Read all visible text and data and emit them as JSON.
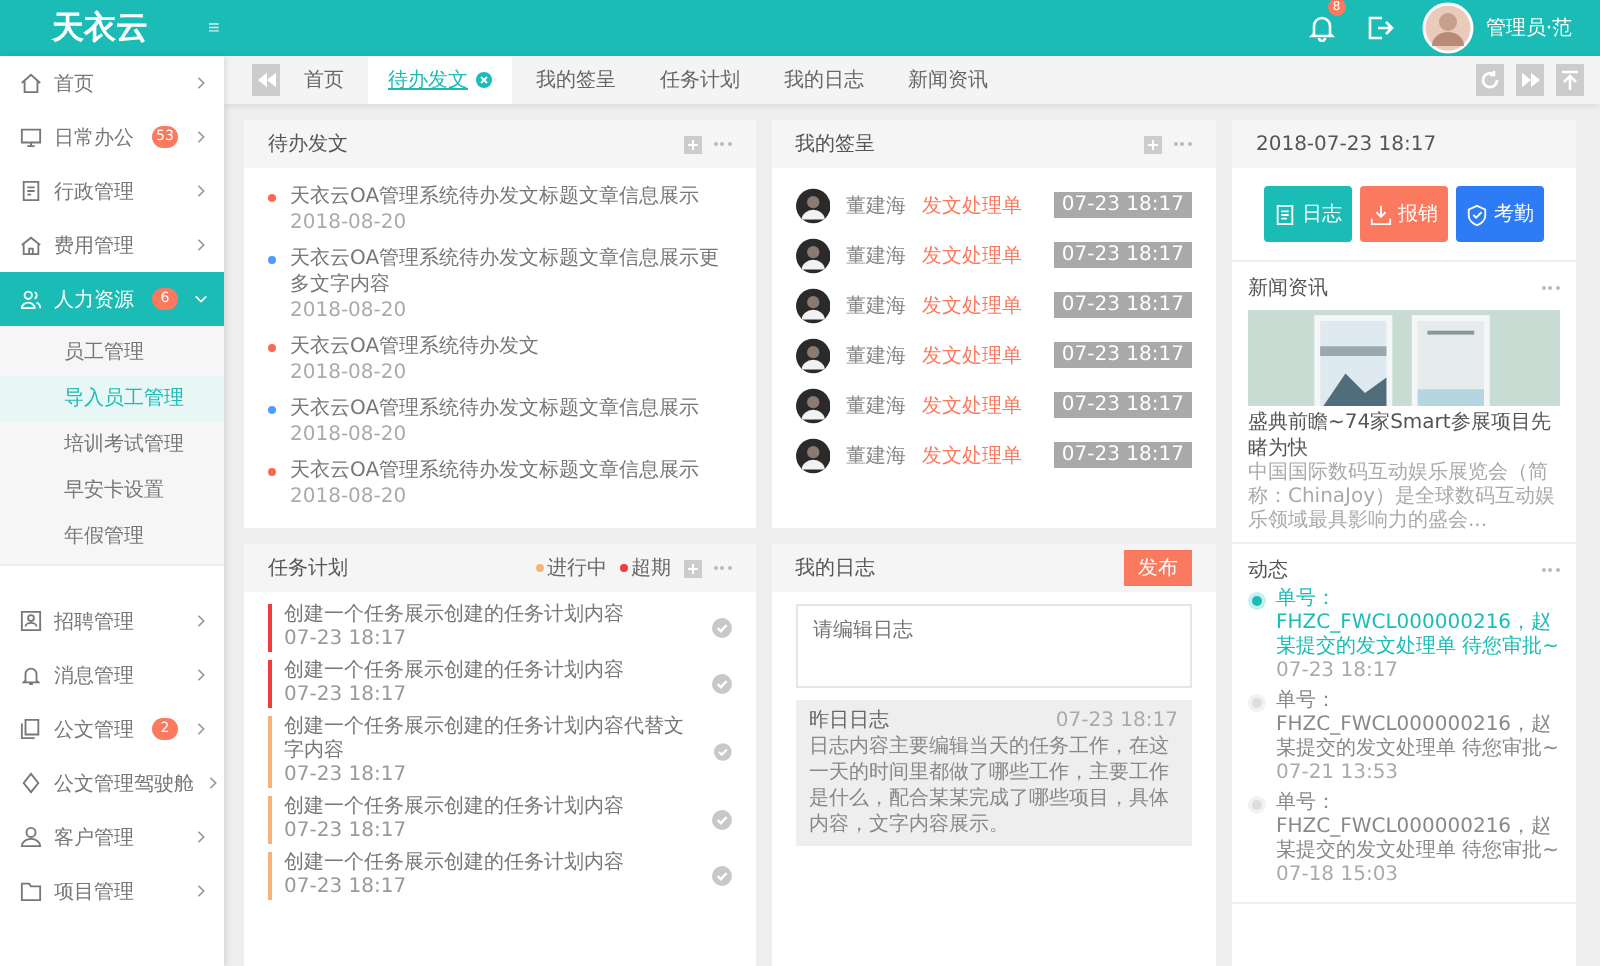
{
  "header": {
    "logo": "天衣云",
    "menu_toggle": "≡",
    "notification_count": "8",
    "user": "管理员·范"
  },
  "sidebar": {
    "items": [
      {
        "label": "首页",
        "selected": false,
        "expanded": false
      },
      {
        "label": "日常办公",
        "badge": "53",
        "selected": false,
        "expanded": false
      },
      {
        "label": "行政管理",
        "selected": false,
        "expanded": false
      },
      {
        "label": "费用管理",
        "selected": false,
        "expanded": false
      },
      {
        "label": "人力资源",
        "badge": "6",
        "selected": true,
        "expanded": true,
        "children": [
          {
            "label": "员工管理",
            "selected": false
          },
          {
            "label": "导入员工管理",
            "selected": true
          },
          {
            "label": "培训考试管理",
            "selected": false
          },
          {
            "label": "早安卡设置",
            "selected": false
          },
          {
            "label": "年假管理",
            "selected": false
          }
        ]
      },
      {
        "label": "招聘管理",
        "selected": false,
        "expanded": false
      },
      {
        "label": "消息管理",
        "selected": false,
        "expanded": false
      },
      {
        "label": "公文管理",
        "badge": "2",
        "selected": false,
        "expanded": false
      },
      {
        "label": "公文管理驾驶舱",
        "selected": false,
        "expanded": false
      },
      {
        "label": "客户管理",
        "selected": false,
        "expanded": false
      },
      {
        "label": "项目管理",
        "selected": false,
        "expanded": false
      }
    ]
  },
  "tabs": [
    {
      "label": "首页",
      "selected": false,
      "closable": false
    },
    {
      "label": "待办发文",
      "selected": true,
      "closable": true
    },
    {
      "label": "我的签呈",
      "selected": false,
      "closable": false
    },
    {
      "label": "任务计划",
      "selected": false,
      "closable": false
    },
    {
      "label": "我的日志",
      "selected": false,
      "closable": false
    },
    {
      "label": "新闻资讯",
      "selected": false,
      "closable": false
    }
  ],
  "pending": {
    "title": "待办发文",
    "items": [
      {
        "title": "天衣云OA管理系统待办发文标题文章信息展示",
        "date": "2018-08-20",
        "color": "#f56c4f"
      },
      {
        "title": "天衣云OA管理系统待办发文标题文章信息展示更多文字内容",
        "date": "2018-08-20",
        "color": "#4d9cf6"
      },
      {
        "title": "天衣云OA管理系统待办发文",
        "date": "2018-08-20",
        "color": "#f56c4f"
      },
      {
        "title": "天衣云OA管理系统待办发文标题文章信息展示",
        "date": "2018-08-20",
        "color": "#4d9cf6"
      },
      {
        "title": "天衣云OA管理系统待办发文标题文章信息展示",
        "date": "2018-08-20",
        "color": "#f56c4f"
      }
    ]
  },
  "signing": {
    "title": "我的签呈",
    "items": [
      {
        "name": "董建海",
        "type": "发文处理单",
        "time": "07-23  18:17"
      },
      {
        "name": "董建海",
        "type": "发文处理单",
        "time": "07-23  18:17"
      },
      {
        "name": "董建海",
        "type": "发文处理单",
        "time": "07-23  18:17"
      },
      {
        "name": "董建海",
        "type": "发文处理单",
        "time": "07-23  18:17"
      },
      {
        "name": "董建海",
        "type": "发文处理单",
        "time": "07-23  18:17"
      },
      {
        "name": "董建海",
        "type": "发文处理单",
        "time": "07-23  18:17"
      }
    ]
  },
  "tasks": {
    "title": "任务计划",
    "legend": [
      {
        "label": "进行中",
        "color": "#f5b27a"
      },
      {
        "label": "超期",
        "color": "#f03c3c"
      }
    ],
    "items": [
      {
        "title": "创建一个任务展示创建的任务计划内容",
        "time": "07-23  18:17",
        "color": "#f03c3c"
      },
      {
        "title": "创建一个任务展示创建的任务计划内容",
        "time": "07-23  18:17",
        "color": "#f03c3c"
      },
      {
        "title": "创建一个任务展示创建的任务计划内容代替文字内容",
        "time": "07-23  18:17",
        "color": "#f5b27a"
      },
      {
        "title": "创建一个任务展示创建的任务计划内容",
        "time": "07-23  18:17",
        "color": "#f5b27a"
      },
      {
        "title": "创建一个任务展示创建的任务计划内容",
        "time": "07-23  18:17",
        "color": "#f5b27a"
      }
    ]
  },
  "journal": {
    "title": "我的日志",
    "publish": "发布",
    "placeholder": "请编辑日志",
    "yesterday": {
      "title": "昨日日志",
      "time": "07-23  18:17",
      "text": "日志内容主要编辑当天的任务工作，在这一天的时间里都做了哪些工作，主要工作是什么，配合某某完成了哪些项目，具体内容，文字内容展示。"
    }
  },
  "side": {
    "datetime": "2018-07-23  18:17",
    "quick": [
      {
        "label": "日志",
        "color": "#1bbcb6"
      },
      {
        "label": "报销",
        "color": "#fb7a5f"
      },
      {
        "label": "考勤",
        "color": "#2d7cf6"
      }
    ],
    "news": {
      "title": "新闻资讯",
      "headline": "盛典前瞻~74家Smart参展项目先睹为快",
      "summary": "中国国际数码互动娱乐展览会（简称：ChinaJoy）是全球数码互动娱乐领域最具影响力的盛会..."
    },
    "activity": {
      "title": "动态",
      "items": [
        {
          "text": "单号：FHZC_FWCL000000216，赵某提交的发文处理单  待您审批~",
          "time": "07-23  18:17",
          "active": true
        },
        {
          "text": "单号：FHZC_FWCL000000216，赵某提交的发文处理单  待您审批~",
          "time": "07-21  13:53",
          "active": false
        },
        {
          "text": "单号：FHZC_FWCL000000216，赵某提交的发文处理单  待您审批~",
          "time": "07-18  15:03",
          "active": false
        }
      ]
    }
  }
}
